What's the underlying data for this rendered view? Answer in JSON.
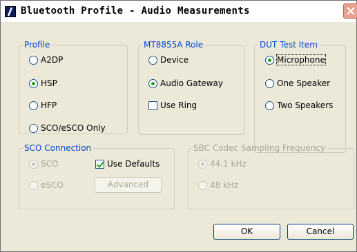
{
  "window": {
    "title": "Bluetooth Profile - Audio Measurements"
  },
  "profile": {
    "legend": "Profile",
    "options": [
      "A2DP",
      "HSP",
      "HFP",
      "SCO/eSCO Only"
    ],
    "selected": "HSP"
  },
  "role": {
    "legend": "MT8855A Role",
    "options": [
      "Device",
      "Audio Gateway"
    ],
    "selected": "Audio Gateway",
    "use_ring": {
      "label": "Use Ring",
      "checked": false
    }
  },
  "dut_test_item": {
    "legend": "DUT Test Item",
    "options": [
      "Microphone",
      "One Speaker",
      "Two Speakers"
    ],
    "selected": "Microphone"
  },
  "sco_connection": {
    "legend": "SCO Connection",
    "options": [
      "SCO",
      "eSCO"
    ],
    "selected": "SCO",
    "use_defaults": {
      "label": "Use Defaults",
      "checked": true
    },
    "advanced_button": "Advanced"
  },
  "sbc_codec": {
    "legend": "SBC Codec Sampling Frequency",
    "options": [
      "44.1 kHz",
      "48 kHz"
    ],
    "selected": "44.1 kHz"
  },
  "buttons": {
    "ok": "OK",
    "cancel": "Cancel"
  }
}
